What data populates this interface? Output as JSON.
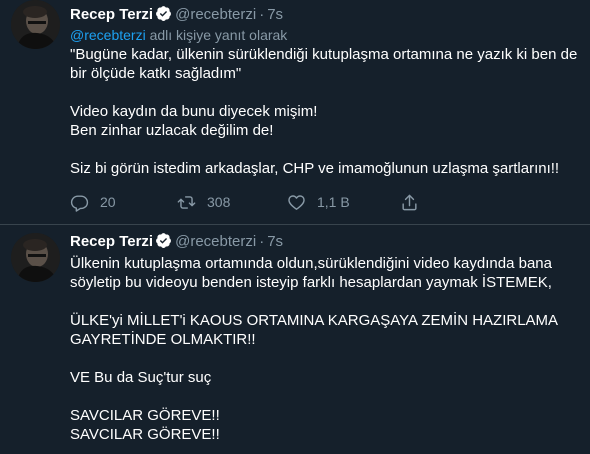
{
  "colors": {
    "background": "#15202b",
    "text": "#ffffff",
    "secondary_text": "#8899a6",
    "link": "#1da1f2",
    "divider": "#38444d"
  },
  "tweets": [
    {
      "author_name": "Recep Terzi",
      "handle": "@recebterzi",
      "separator": "·",
      "time": "7s",
      "reply_mention": "@recebterzi",
      "reply_text": " adlı kişiye yanıt olarak",
      "lines": [
        "\"Bugüne kadar, ülkenin sürüklendiği kutuplaşma ortamına ne yazık ki ben de",
        "bir ölçüde katkı sağladım\"",
        "",
        "Video kaydın da bunu diyecek mişim!",
        "Ben zinhar uzlacak değilim de!",
        "",
        "Siz bi görün istedim arkadaşlar, CHP ve imamoğlunun uzlaşma şartlarını!!"
      ],
      "actions": {
        "reply_icon": "reply-icon",
        "reply_count": "20",
        "retweet_icon": "retweet-icon",
        "retweet_count": "308",
        "like_icon": "heart-icon",
        "like_count": "1,1 B",
        "share_icon": "share-icon"
      }
    },
    {
      "author_name": "Recep Terzi",
      "handle": "@recebterzi",
      "separator": "·",
      "time": "7s",
      "lines": [
        "Ülkenin kutuplaşma ortamında oldun,sürüklendiğini video kaydında bana",
        "söyletip bu videoyu benden isteyip farklı hesaplardan yaymak İSTEMEK,",
        "",
        "ÜLKE'yi MİLLET'i KAOUS ORTAMINA KARGAŞAYA ZEMİN HAZIRLAMA",
        "GAYRETİNDE OLMAKTIR!!",
        "",
        "VE Bu da Suç'tur suç",
        "",
        "SAVCILAR GÖREVE!!",
        "SAVCILAR GÖREVE!!"
      ]
    }
  ]
}
